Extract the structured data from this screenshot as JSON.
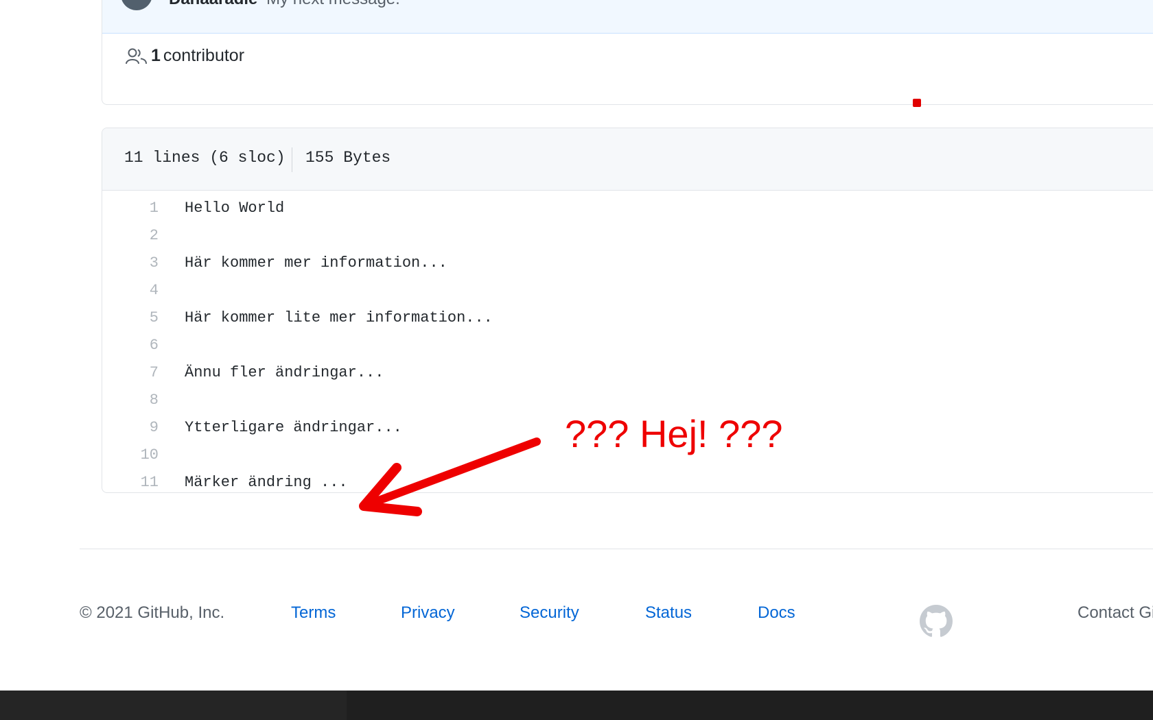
{
  "commit": {
    "author": "Danaaradie",
    "message": "My next message."
  },
  "contributors": {
    "count": "1",
    "label": "contributor"
  },
  "file": {
    "lines_info": "11 lines (6 sloc)",
    "size": "155 Bytes",
    "code_lines": [
      {
        "n": "1",
        "text": "Hello World"
      },
      {
        "n": "2",
        "text": ""
      },
      {
        "n": "3",
        "text": "Här kommer mer information..."
      },
      {
        "n": "4",
        "text": ""
      },
      {
        "n": "5",
        "text": "Här kommer lite mer information..."
      },
      {
        "n": "6",
        "text": ""
      },
      {
        "n": "7",
        "text": "Ännu fler ändringar..."
      },
      {
        "n": "8",
        "text": ""
      },
      {
        "n": "9",
        "text": "Ytterligare ändringar..."
      },
      {
        "n": "10",
        "text": ""
      },
      {
        "n": "11",
        "text": "Märker ändring ..."
      }
    ]
  },
  "annotation": {
    "text": "??? Hej! ???",
    "color": "#ee0000"
  },
  "footer": {
    "copyright": "© 2021 GitHub, Inc.",
    "links": [
      "Terms",
      "Privacy",
      "Security",
      "Status",
      "Docs"
    ],
    "logo_icon": "github-mark-icon",
    "contact": "Contact Gi"
  },
  "colors": {
    "link": "#0366d6",
    "commit_bg": "#f1f8ff",
    "file_header_bg": "#f6f8fa",
    "taskbar": "#1f1f1f"
  }
}
